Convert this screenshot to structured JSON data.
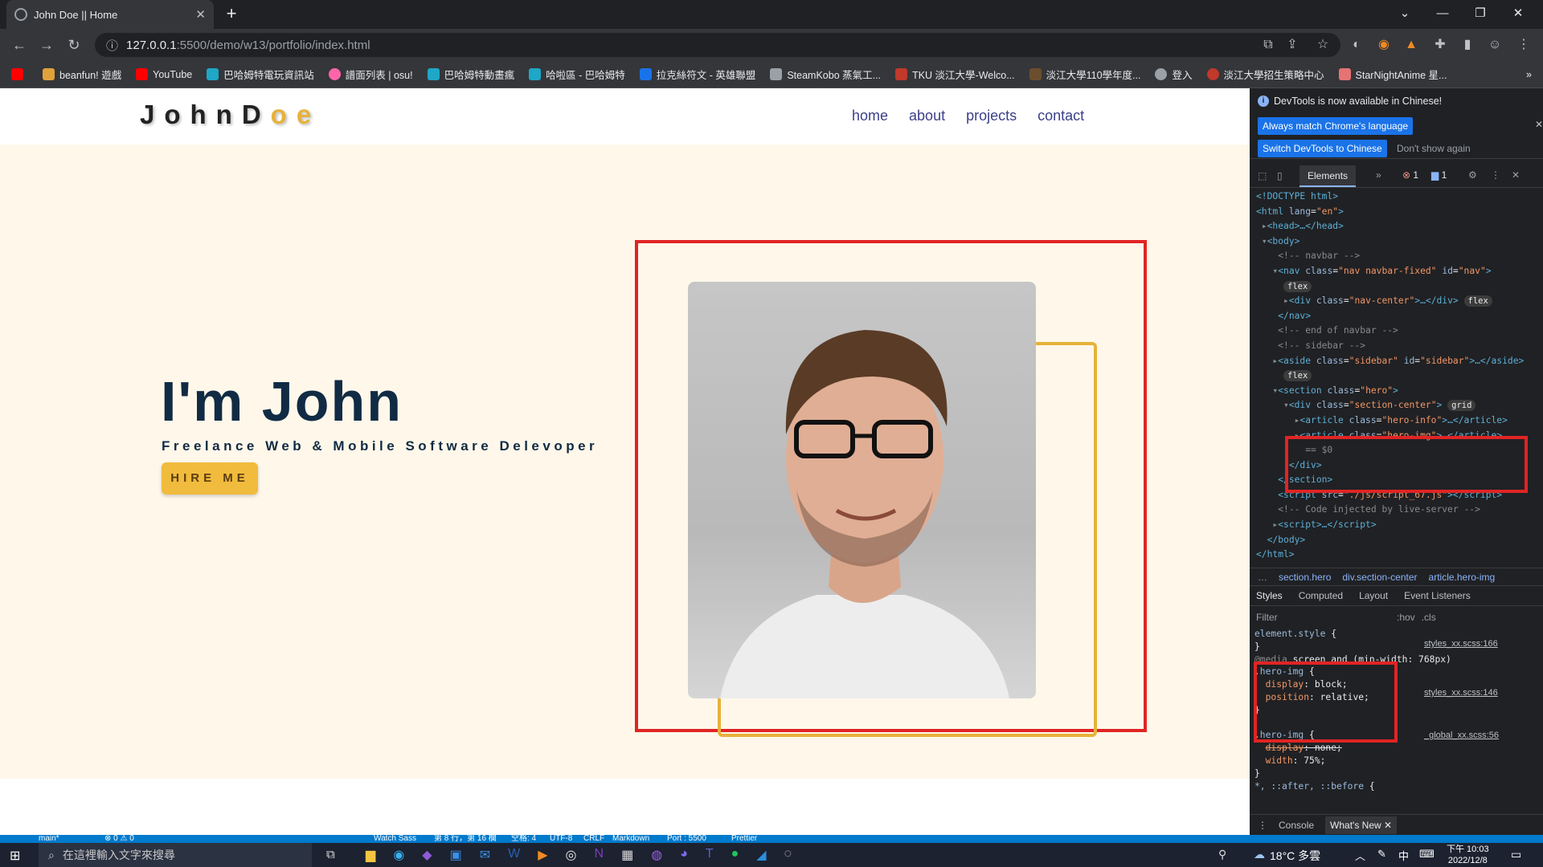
{
  "browser": {
    "tab_title": "John Doe || Home",
    "url_host": "127.0.0.1",
    "url_path": ":5500/demo/w13/portfolio/index.html",
    "bookmarks": [
      "beanfun! 遊戲",
      "YouTube",
      "巴哈姆特電玩資訊站",
      "譜面列表 | osu!",
      "巴哈姆特動畫瘋",
      "哈啦區 - 巴哈姆特",
      "拉克絲符文 - 英雄聯盟",
      "SteamKobo 蒸氣工...",
      "TKU 淡江大學-Welco...",
      "淡江大學110學年度...",
      "登入",
      "淡江大學招生策略中心",
      "StarNightAnime 星..."
    ],
    "bookmark_colors": [
      "#e1a23a",
      "#ff0000",
      "#1ea7c7",
      "#ff66aa",
      "#1ea7c7",
      "#1ea7c7",
      "#1a73e8",
      "#9aa0a6",
      "#c0392b",
      "#6b4e2e",
      "#9aa0a6",
      "#c0392b",
      "#e57373"
    ]
  },
  "site": {
    "logo_main": "JohnD",
    "logo_accent": "oe",
    "nav": [
      "home",
      "about",
      "projects",
      "contact"
    ],
    "hero_title": "I'm John",
    "hero_subtitle": "Freelance Web & Mobile Software Delevoper",
    "hire_label": "HIRE ME"
  },
  "devtools": {
    "banner_text": "DevTools is now available in Chinese!",
    "btn_match": "Always match Chrome's language",
    "btn_switch": "Switch DevTools to Chinese",
    "btn_dont": "Don't show again",
    "tab_elements": "Elements",
    "errors": "1",
    "messages": "1",
    "breadcrumb": [
      "section.hero",
      "div.section-center",
      "article.hero-img"
    ],
    "panel_tabs": [
      "Styles",
      "Computed",
      "Layout",
      "Event Listeners"
    ],
    "filter_placeholder": "Filter",
    "hov": ":hov",
    "cls": ".cls",
    "drawer_tabs": [
      "Console",
      "What's New"
    ],
    "style_src1": "styles_xx.scss:166",
    "style_src2": "styles_xx.scss:146",
    "style_src3": "_global_xx.scss:56"
  },
  "taskbar": {
    "search_placeholder": "在這裡輸入文字來搜尋",
    "weather": "18°C 多雲",
    "ime": "中",
    "time": "下午 10:03",
    "date": "2022/12/8"
  },
  "vscode_status": {
    "branch": "main*",
    "problems": "⊗ 0 ⚠ 0",
    "watch": "Watch Sass",
    "position": "第 8 行，第 16 欄",
    "spaces": "空格: 4",
    "encoding": "UTF-8",
    "eol": "CRLF",
    "lang": "Markdown",
    "port": "Port : 5500",
    "prettier": "Prettier"
  }
}
